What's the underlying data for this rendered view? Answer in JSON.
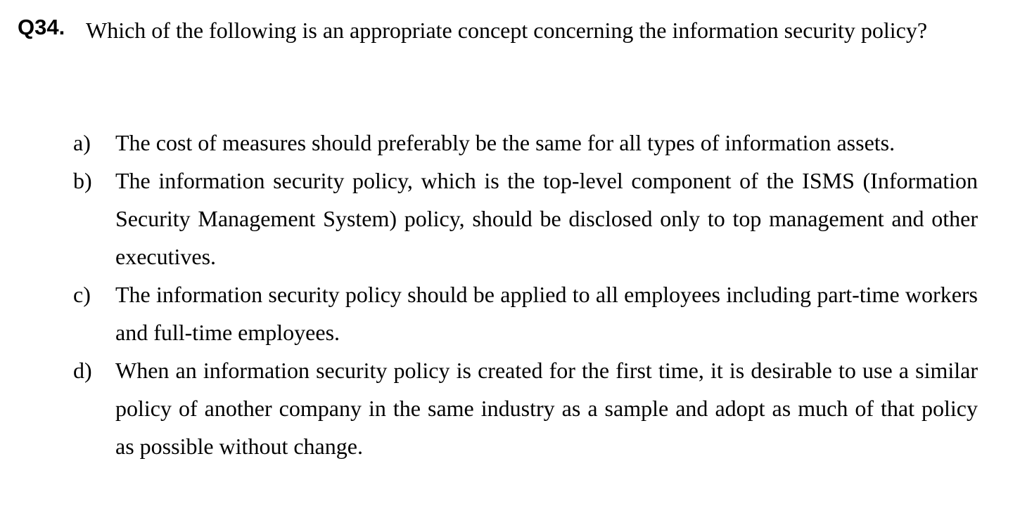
{
  "question": {
    "number": "Q34.",
    "text": "Which of the following is an appropriate concept concerning the information security policy?"
  },
  "options": [
    {
      "letter": "a)",
      "text": "The cost of measures should preferably be the same for all types of information assets."
    },
    {
      "letter": "b)",
      "text": "The information security policy, which is the top-level component of the ISMS (Information Security Management System) policy, should be disclosed only to top management and other executives."
    },
    {
      "letter": "c)",
      "text": "The information security policy should be applied to all employees including part-time workers and full-time employees."
    },
    {
      "letter": "d)",
      "text": "When an information security policy is created for the first time, it is desirable to use a similar policy of another company in the same industry as a sample and adopt as much of that policy as possible without change."
    }
  ]
}
